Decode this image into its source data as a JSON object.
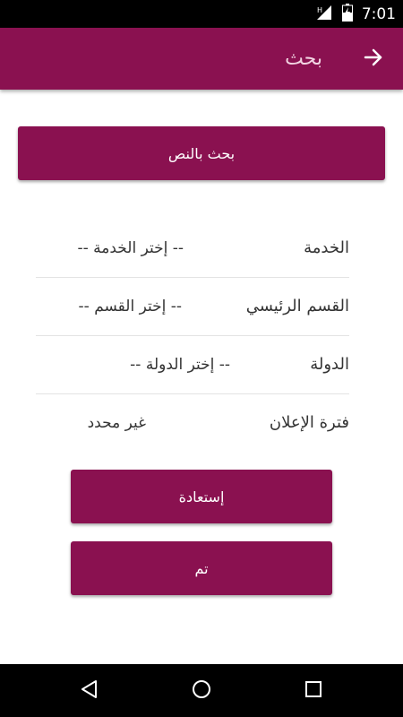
{
  "status_bar": {
    "time": "7:01",
    "icons": [
      "signal-h-icon",
      "battery-charging-icon"
    ]
  },
  "app_bar": {
    "title": "بحث",
    "back_icon": "arrow-right-icon"
  },
  "search_by_text_button": "بحث بالنص",
  "filters": [
    {
      "label": "الخدمة",
      "value": "-- إختر الخدمة --"
    },
    {
      "label": "القسم الرئيسي",
      "value": "-- إختر القسم --"
    },
    {
      "label": "الدولة",
      "value": "-- إختر الدولة --"
    },
    {
      "label": "فترة الإعلان",
      "value": "غير محدد"
    }
  ],
  "buttons": {
    "reset": "إستعادة",
    "done": "تم"
  },
  "nav_bar": {
    "icons": [
      "back-triangle-icon",
      "home-circle-icon",
      "recents-square-icon"
    ]
  },
  "colors": {
    "primary": "#8a1150",
    "status_bar": "#000000",
    "title_text": "#f2d4e2"
  }
}
